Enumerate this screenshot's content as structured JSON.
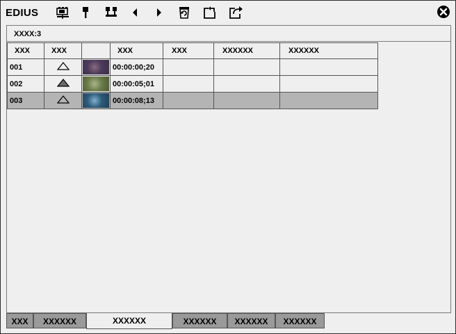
{
  "app": {
    "logo": "EDIUS"
  },
  "toolbar": {
    "buttons": [
      {
        "icon": "add-clip-icon"
      },
      {
        "icon": "mark-in-icon"
      },
      {
        "icon": "split-marker-icon"
      },
      {
        "icon": "previous-arrow-icon"
      },
      {
        "icon": "next-arrow-icon"
      },
      {
        "icon": "refresh-icon"
      },
      {
        "icon": "import-icon"
      },
      {
        "icon": "export-icon"
      }
    ],
    "close_icon": "close-circle-icon"
  },
  "panel": {
    "count_label": "XXXX:3",
    "columns": [
      "XXX",
      "XXX",
      "",
      "XXX",
      "XXX",
      "XXXXXX",
      "XXXXXX"
    ],
    "rows": [
      {
        "num": "001",
        "marker": "outline",
        "timecode": "00:00:00;20",
        "thumb_colors": [
          "#4a3a5c",
          "#8a6a7e",
          "#3d2f45"
        ],
        "selected": false
      },
      {
        "num": "002",
        "marker": "filled",
        "timecode": "00:00:05;01",
        "thumb_colors": [
          "#6b7c4a",
          "#a9b58a",
          "#4f5a36"
        ],
        "selected": false
      },
      {
        "num": "003",
        "marker": "outline",
        "timecode": "00:00:08;13",
        "thumb_colors": [
          "#2e5b7a",
          "#7fb0cf",
          "#1f3f55"
        ],
        "selected": true
      }
    ]
  },
  "tabs": [
    "XXX",
    "XXXXXX",
    "XXXXXX",
    "XXXXXX",
    "XXXXXX",
    "XXXXXX"
  ],
  "active_tab": 2
}
